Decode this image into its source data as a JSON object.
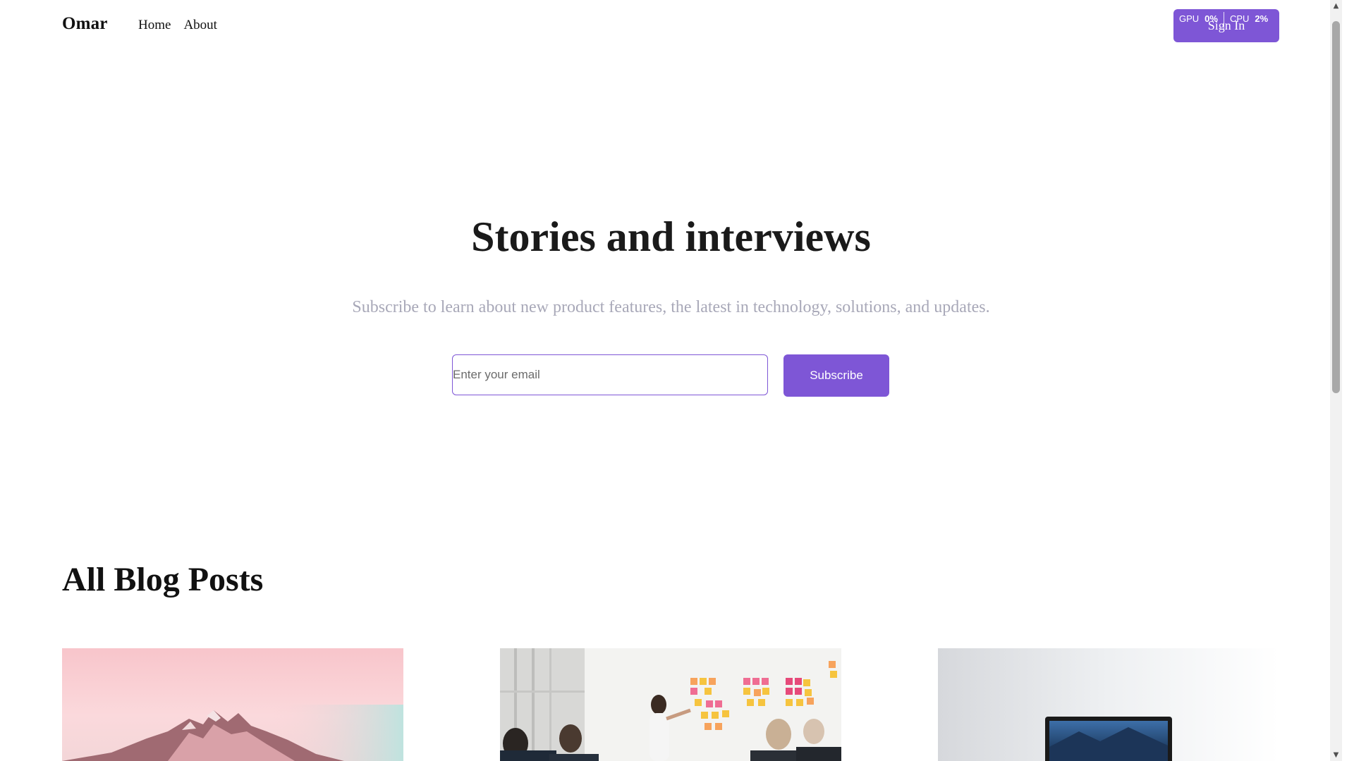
{
  "header": {
    "brand": "Omar",
    "nav": [
      "Home",
      "About"
    ],
    "signin_label": "Sign In"
  },
  "perf_overlay": {
    "gpu_label": "GPU",
    "gpu_value": "0%",
    "cpu_label": "CPU",
    "cpu_value": "2%"
  },
  "hero": {
    "title": "Stories and interviews",
    "subtitle": "Subscribe to learn about new product features, the latest in technology, solutions, and updates.",
    "email_placeholder": "Enter your email",
    "subscribe_label": "Subscribe"
  },
  "blog": {
    "heading": "All Blog Posts",
    "cards": [
      {
        "image": "pink-mountain-photo"
      },
      {
        "image": "office-sticky-notes-meeting-photo"
      },
      {
        "image": "laptop-on-desk-photo"
      }
    ]
  },
  "colors": {
    "accent": "#7e56d6",
    "subtitle_gray": "#a8a8b8",
    "text_dark": "#111111"
  }
}
